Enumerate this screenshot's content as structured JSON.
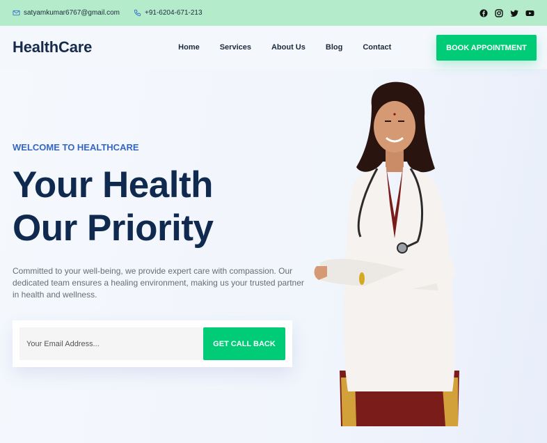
{
  "topbar": {
    "email": "satyamkumar6767@gmail.com",
    "phone": "+91-6204-671-213",
    "social_icons": [
      "facebook-icon",
      "instagram-icon",
      "twitter-icon",
      "youtube-icon"
    ]
  },
  "navbar": {
    "logo": "HealthCare",
    "links": [
      "Home",
      "Services",
      "About Us",
      "Blog",
      "Contact"
    ],
    "cta": "BOOK APPOINTMENT"
  },
  "hero": {
    "welcome": "WELCOME TO HEALTHCARE",
    "title_line1": "Your Health",
    "title_line2": "Our Priority",
    "description": "Committed to your well-being, we provide expert care with compassion. Our dedicated team ensures a healing environment, making us your trusted partner in health and wellness.",
    "email_placeholder": "Your Email Address...",
    "cta": "GET CALL BACK"
  },
  "colors": {
    "accent": "#00cc78",
    "topbar": "#b3ebcb",
    "heading": "#102a4f",
    "welcome": "#3466c4"
  }
}
